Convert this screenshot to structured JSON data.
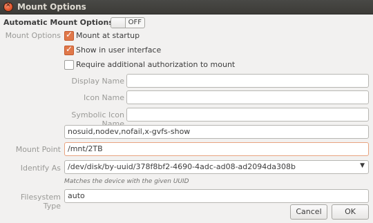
{
  "window": {
    "title": "Mount Options",
    "close_icon": "close-icon"
  },
  "automatic": {
    "label": "Automatic Mount Options",
    "switch_state": "OFF"
  },
  "mount_options": {
    "section_label": "Mount Options",
    "mount_at_startup": {
      "label": "Mount at startup",
      "checked": true
    },
    "show_in_ui": {
      "label": "Show in user interface",
      "checked": true
    },
    "require_auth": {
      "label": "Require additional authorization to mount",
      "checked": false
    },
    "display_name": {
      "label": "Display Name",
      "value": ""
    },
    "icon_name": {
      "label": "Icon Name",
      "value": ""
    },
    "symbolic_icon_name": {
      "label": "Symbolic Icon Name",
      "value": ""
    },
    "options_value": "nosuid,nodev,nofail,x-gvfs-show"
  },
  "mount_point": {
    "label": "Mount Point",
    "value": "/mnt/2TB"
  },
  "identify_as": {
    "label": "Identify As",
    "value": "/dev/disk/by-uuid/378f8bf2-4690-4adc-ad08-ad2094da308b",
    "hint": "Matches the device with the given UUID"
  },
  "filesystem_type": {
    "label": "Filesystem Type",
    "value": "auto"
  },
  "buttons": {
    "cancel": "Cancel",
    "ok": "OK"
  },
  "colors": {
    "titlebar": "#3c3b37",
    "accent": "#e0784a",
    "background": "#f2f1f0"
  }
}
